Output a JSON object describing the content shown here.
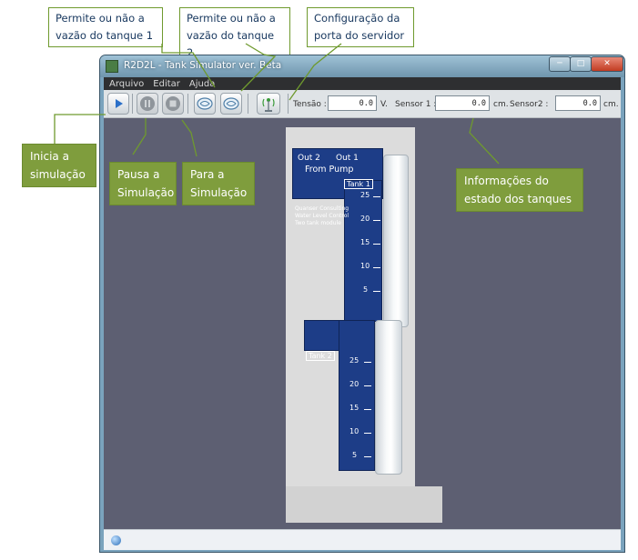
{
  "callouts": {
    "vazao1": "Permite ou não a vazão do tanque 1",
    "vazao2": "Permite ou não a vazão do tanque 2",
    "porta": "Configuração da porta do servidor",
    "inicia": "Inicia a simulação",
    "pausa": "Pausa a Simulação",
    "para": "Para a Simulação",
    "info": "Informações do estado dos tanques"
  },
  "window": {
    "title": "R2D2L - Tank Simulator ver. Beta"
  },
  "menu": [
    "Arquivo",
    "Editar",
    "Ajuda"
  ],
  "toolbar": {
    "tensao_label": "Tensão :",
    "tensao_value": "0.0",
    "tensao_unit": "V.",
    "sensor1_label": "Sensor 1 :",
    "sensor1_value": "0.0",
    "sensor1_unit": "cm.",
    "sensor2_label": "Sensor2 :",
    "sensor2_value": "0.0",
    "sensor2_unit": "cm."
  },
  "tank": {
    "out2": "Out 2",
    "out1": "Out 1",
    "from_pump": "From Pump",
    "tank1": "Tank 1",
    "tank2": "Tank 2",
    "brand_line1": "Quanser Consulting",
    "brand_line2": "Water Level Control",
    "brand_line3": "Two tank module",
    "scale": [
      "25",
      "20",
      "15",
      "10",
      "5"
    ]
  },
  "colors": {
    "callout_border": "#6f9a2e",
    "callout_fill_dark": "#7f9d3d",
    "tank_panel": "#1d3d87"
  },
  "icons": [
    "play-icon",
    "pause-icon",
    "stop-icon",
    "valve-tank1-icon",
    "valve-tank2-icon",
    "server-antenna-icon"
  ]
}
